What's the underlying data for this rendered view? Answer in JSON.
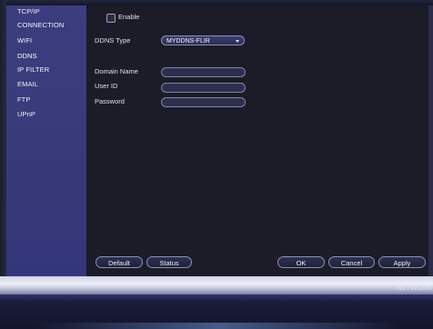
{
  "sidebar": {
    "items": [
      {
        "label": "TCP/IP",
        "active": false
      },
      {
        "label": "CONNECTION",
        "active": false
      },
      {
        "label": "WIFI",
        "active": false
      },
      {
        "label": "DDNS",
        "active": true
      },
      {
        "label": "IP FILTER",
        "active": false
      },
      {
        "label": "EMAIL",
        "active": false
      },
      {
        "label": "FTP",
        "active": false
      },
      {
        "label": "UPnP",
        "active": false
      }
    ]
  },
  "form": {
    "enable_label": "Enable",
    "enable_checked": false,
    "ddns_type_label": "DDNS Type",
    "ddns_type_value": "MYDDNS-FLIR",
    "domain_name_label": "Domain Name",
    "domain_name_value": "",
    "user_id_label": "User ID",
    "user_id_value": "",
    "password_label": "Password",
    "password_value": ""
  },
  "buttons": {
    "default": "Default",
    "status": "Status",
    "ok": "OK",
    "cancel": "Cancel",
    "apply": "Apply"
  },
  "footer": {
    "section_label": "NETWORK"
  },
  "colors": {
    "sidebar_bg": "#3a3c7c",
    "panel_bg": "#1b1c28",
    "field_bg": "#2d2f4c"
  }
}
